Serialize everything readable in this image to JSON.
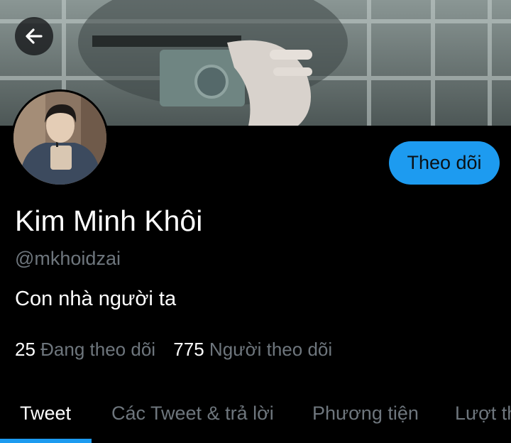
{
  "profile": {
    "name": "Kim Minh Khôi",
    "handle": "@mkhoidzai",
    "bio": "Con nhà người ta"
  },
  "actions": {
    "follow_label": "Theo dõi"
  },
  "stats": {
    "following_count": "25",
    "following_label": "Đang theo dõi",
    "followers_count": "775",
    "followers_label": "Người theo dõi"
  },
  "tabs": [
    {
      "label": "Tweet",
      "active": true
    },
    {
      "label": "Các Tweet & trả lời",
      "active": false
    },
    {
      "label": "Phương tiện",
      "active": false
    },
    {
      "label": "Lượt th",
      "active": false
    }
  ],
  "colors": {
    "accent": "#1d9bf0",
    "muted_text": "#6e767d",
    "background": "#000000"
  },
  "icons": {
    "back": "arrow-left-icon"
  }
}
